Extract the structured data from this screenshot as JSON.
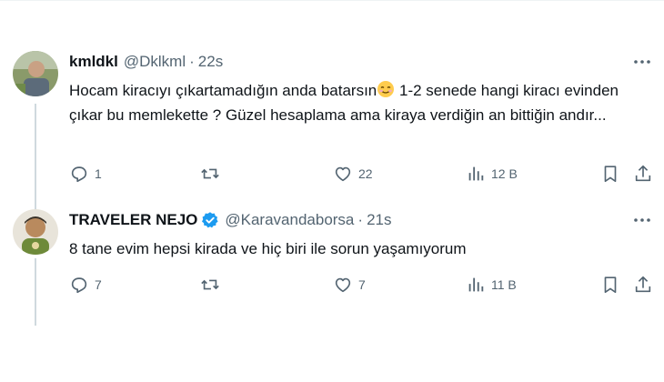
{
  "tweets": [
    {
      "name": "kmldkl",
      "handle": "@Dklkml",
      "separator": "·",
      "time": "22s",
      "verified": false,
      "text_parts": [
        "Hocam kiracıyı çıkartamadığın anda batarsın",
        " 1-2 senede hangi kiracı evinden çıkar bu memlekette ? Güzel hesaplama ama kiraya verdiğin an bittiğin andır..."
      ],
      "emoji_icon": "smiling-face-icon",
      "replies": "1",
      "retweets": "",
      "likes": "22",
      "views": "12 B"
    },
    {
      "name": "TRAVELER NEJO",
      "handle": "@Karavandaborsa",
      "separator": "·",
      "time": "21s",
      "verified": true,
      "text": "8 tane evim hepsi kirada ve hiç biri ile sorun yaşamıyorum",
      "replies": "7",
      "retweets": "",
      "likes": "7",
      "views": "11 B"
    }
  ],
  "colors": {
    "text": "#0f1419",
    "secondary": "#536471",
    "verified": "#1d9bf0",
    "thread_line": "#cfd9de"
  },
  "icons": [
    "reply-icon",
    "retweet-icon",
    "like-icon",
    "views-icon",
    "bookmark-icon",
    "share-icon",
    "more-icon",
    "verified-badge-icon"
  ]
}
